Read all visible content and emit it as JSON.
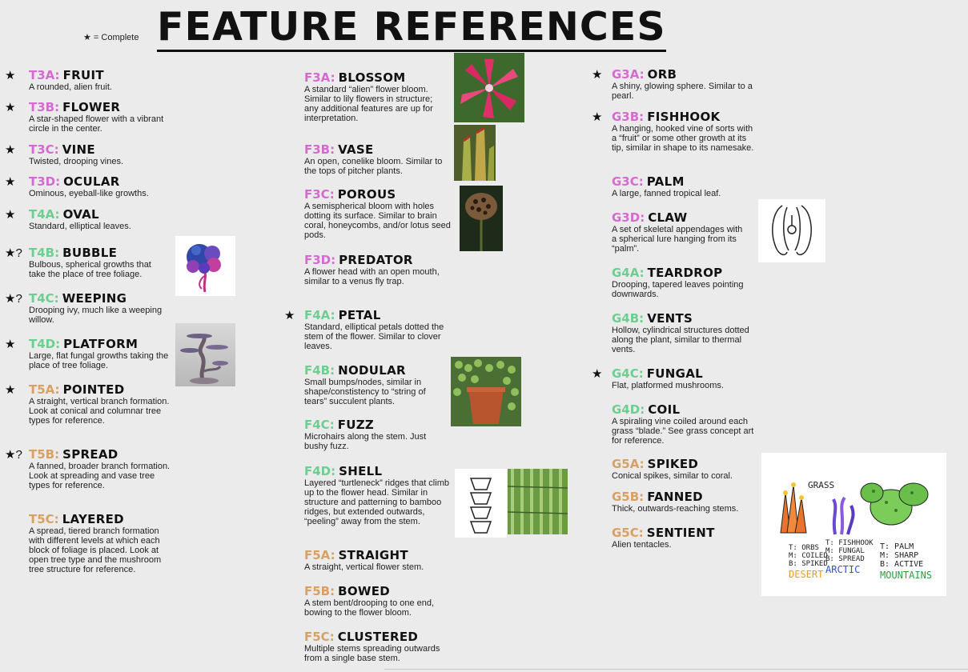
{
  "header": {
    "title": "FEATURE REFERENCES",
    "legend": "★ = Complete"
  },
  "colors": {
    "tier3": "#d56bd0",
    "tier4": "#6ccf8f",
    "tier5": "#d8a062"
  },
  "col1": [
    {
      "mark": "★",
      "code": "T3A:",
      "name": "FRUIT",
      "desc": "A rounded, alien fruit."
    },
    {
      "mark": "★",
      "code": "T3B:",
      "name": "FLOWER",
      "desc": "A star-shaped flower with a vibrant circle in the center."
    },
    {
      "mark": "★",
      "code": "T3C:",
      "name": "VINE",
      "desc": "Twisted, drooping vines."
    },
    {
      "mark": "★",
      "code": "T3D:",
      "name": "OCULAR",
      "desc": "Ominous, eyeball-like growths."
    },
    {
      "mark": "★",
      "code": "T4A:",
      "name": "OVAL",
      "desc": "Standard, elliptical leaves."
    },
    {
      "mark": "★?",
      "code": "T4B:",
      "name": "BUBBLE",
      "desc": "Bulbous, spherical growths that take the place of tree foliage."
    },
    {
      "mark": "★?",
      "code": "T4C:",
      "name": "WEEPING",
      "desc": "Drooping ivy, much like a weeping willow."
    },
    {
      "mark": "★",
      "code": "T4D:",
      "name": "PLATFORM",
      "desc": "Large, flat fungal growths taking the place of tree foliage."
    },
    {
      "mark": "★",
      "code": "T5A:",
      "name": "POINTED",
      "desc": "A straight, vertical branch formation. Look at conical and columnar tree types for reference."
    },
    {
      "mark": "★?",
      "code": "T5B:",
      "name": "SPREAD",
      "desc": "A fanned, broader branch formation. Look at spreading and vase tree types for reference."
    },
    {
      "mark": "",
      "code": "T5C:",
      "name": "LAYERED",
      "desc": "A spread, tiered branch formation with different levels at which each block of foliage is placed. Look at open tree type and the mushroom tree structure for reference."
    }
  ],
  "col2": [
    {
      "mark": "",
      "code": "F3A:",
      "name": "BLOSSOM",
      "desc": "A standard “alien” flower bloom. Similar to lily flowers in structure; any additional features are up for interpretation."
    },
    {
      "mark": "",
      "code": "F3B:",
      "name": "VASE",
      "desc": "An open, conelike bloom. Similar to the tops of pitcher plants."
    },
    {
      "mark": "",
      "code": "F3C:",
      "name": "POROUS",
      "desc": "A semispherical bloom with holes dotting its surface. Similar to brain coral, honeycombs, and/or lotus seed pods."
    },
    {
      "mark": "",
      "code": "F3D:",
      "name": "PREDATOR",
      "desc": "A flower head with an open mouth, similar to a venus fly trap."
    },
    {
      "mark": "★",
      "code": "F4A:",
      "name": "PETAL",
      "desc": "Standard, elliptical petals dotted the stem of the flower. Similar to clover leaves."
    },
    {
      "mark": "",
      "code": "F4B:",
      "name": "NODULAR",
      "desc": "Small bumps/nodes, similar in shape/constistency to “string of tears” succulent plants."
    },
    {
      "mark": "",
      "code": "F4C:",
      "name": "FUZZ",
      "desc": "Microhairs along the stem. Just bushy fuzz."
    },
    {
      "mark": "",
      "code": "F4D:",
      "name": "SHELL",
      "desc": "Layered “turtleneck” ridges that climb up to the flower head. Similar in structure and patterning to bamboo ridges, but extended outwards, “peeling” away from the stem."
    },
    {
      "mark": "",
      "code": "F5A:",
      "name": "STRAIGHT",
      "desc": "A straight, vertical flower stem."
    },
    {
      "mark": "",
      "code": "F5B:",
      "name": "BOWED",
      "desc": "A stem bent/drooping to one end, bowing to the flower bloom."
    },
    {
      "mark": "",
      "code": "F5C:",
      "name": "CLUSTERED",
      "desc": "Multiple stems spreading outwards from a single base stem."
    }
  ],
  "col3": [
    {
      "mark": "★",
      "code": "G3A:",
      "name": "ORB",
      "desc": "A shiny, glowing sphere. Similar to a pearl."
    },
    {
      "mark": "★",
      "code": "G3B:",
      "name": "FISHHOOK",
      "desc": "A hanging, hooked vine of sorts with a “fruit” or some other growth at its tip, similar in shape to its namesake."
    },
    {
      "mark": "",
      "code": "G3C:",
      "name": "PALM",
      "desc": "A large, fanned tropical leaf."
    },
    {
      "mark": "",
      "code": "G3D:",
      "name": "CLAW",
      "desc": "A set of skeletal appendages with a spherical lure hanging from its “palm”."
    },
    {
      "mark": "",
      "code": "G4A:",
      "name": "TEARDROP",
      "desc": "Drooping, tapered leaves pointing downwards."
    },
    {
      "mark": "",
      "code": "G4B:",
      "name": "VENTS",
      "desc": "Hollow, cylindrical structures dotted along the plant, similar to thermal vents."
    },
    {
      "mark": "★",
      "code": "G4C:",
      "name": "FUNGAL",
      "desc": "Flat, platformed mushrooms."
    },
    {
      "mark": "",
      "code": "G4D:",
      "name": "COIL",
      "desc": "A spiraling vine coiled around each grass “blade.” See grass concept art for reference."
    },
    {
      "mark": "",
      "code": "G5A:",
      "name": "SPIKED",
      "desc": "Conical spikes, similar to coral."
    },
    {
      "mark": "",
      "code": "G5B:",
      "name": "FANNED",
      "desc": "Thick, outwards-reaching stems."
    },
    {
      "mark": "",
      "code": "G5C:",
      "name": "SENTIENT",
      "desc": "Alien tentacles."
    }
  ],
  "grass_art": {
    "title": "GRASS",
    "desert": {
      "t": "T: ORBS",
      "m": "M: COILED",
      "b": "B: SPIKED",
      "label": "DESERT"
    },
    "arctic": {
      "t": "T: FISHHOOK",
      "m": "M: FUNGAL",
      "b": "B: SPREAD",
      "label": "ARCTIC"
    },
    "mountains": {
      "t": "T: PALM",
      "m": "M: SHARP",
      "b": "B: ACTIVE",
      "label": "MOUNTAINS"
    }
  }
}
